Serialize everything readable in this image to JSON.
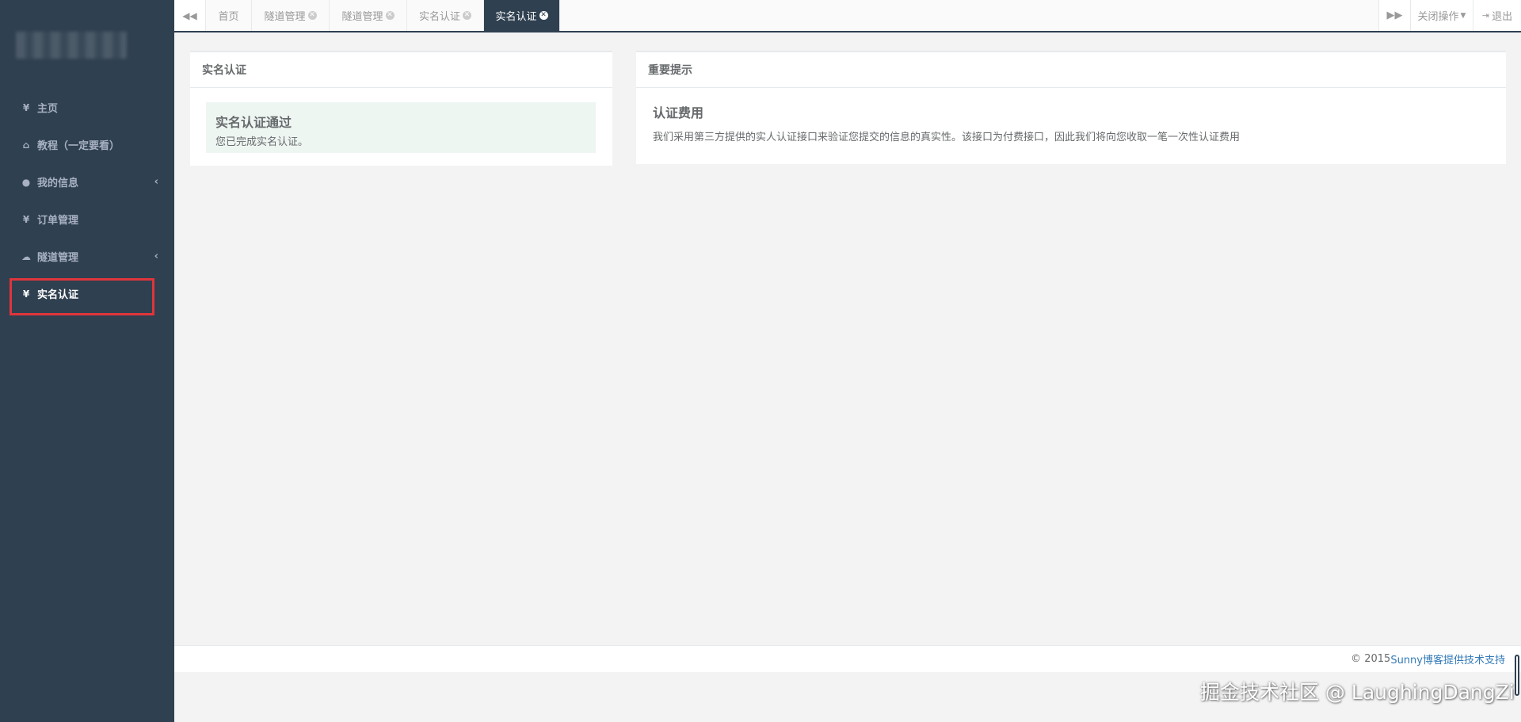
{
  "sidebar": {
    "items": [
      {
        "icon": "yen-icon",
        "glyph": "¥",
        "label": "主页"
      },
      {
        "icon": "home-icon",
        "glyph": "⌂",
        "label": "教程（一定要看）"
      },
      {
        "icon": "user-icon",
        "glyph": "●",
        "label": "我的信息",
        "has_submenu": true
      },
      {
        "icon": "yen-icon",
        "glyph": "¥",
        "label": "订单管理"
      },
      {
        "icon": "cloud-icon",
        "glyph": "☁",
        "label": "隧道管理",
        "has_submenu": true
      },
      {
        "icon": "yen-icon",
        "glyph": "¥",
        "label": "实名认证",
        "active": true,
        "highlighted": true
      }
    ]
  },
  "tabs": [
    {
      "label": "首页",
      "closable": false
    },
    {
      "label": "隧道管理",
      "closable": true
    },
    {
      "label": "隧道管理",
      "closable": true
    },
    {
      "label": "实名认证",
      "closable": true
    },
    {
      "label": "实名认证",
      "closable": true,
      "active": true
    }
  ],
  "topbar": {
    "close_ops_label": "关闭操作",
    "logout_label": "退出"
  },
  "verification_panel": {
    "title": "实名认证",
    "alert_title": "实名认证通过",
    "alert_text": "您已完成实名认证。"
  },
  "notice_panel": {
    "title": "重要提示",
    "heading": "认证费用",
    "text": "我们采用第三方提供的实人认证接口来验证您提交的信息的真实性。该接口为付费接口，因此我们将向您收取一笔一次性认证费用"
  },
  "footer": {
    "copyright": "© 2015 ",
    "link_text": "Sunny博客提供技术支持"
  },
  "watermark": "掘金技术社区 @ LaughingDangZi",
  "colors": {
    "sidebar_bg": "#2f4050",
    "active_tab_bg": "#2f4050",
    "highlight_border": "#e0343b",
    "alert_bg": "#eef6f2",
    "link": "#337ab7"
  }
}
